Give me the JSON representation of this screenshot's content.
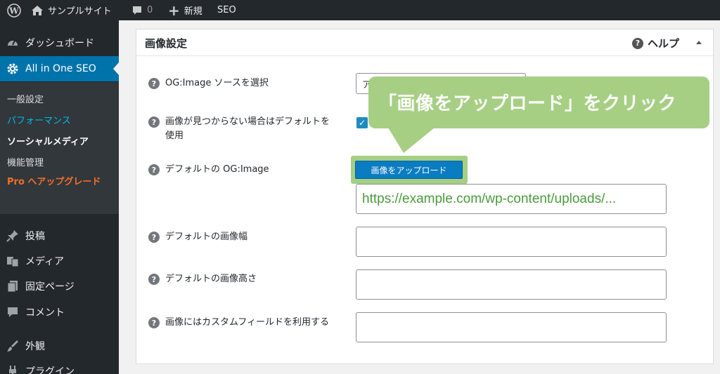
{
  "adminbar": {
    "site_name": "サンプルサイト",
    "comments_count": "0",
    "new_label": "新規",
    "seo_label": "SEO"
  },
  "sidebar": {
    "dashboard": "ダッシュボード",
    "aioseo": "All in One SEO",
    "submenu": {
      "general": "一般設定",
      "performance": "パフォーマンス",
      "social": "ソーシャルメディア",
      "features": "機能管理",
      "pro_prefix": "Pro",
      "pro_rest": " へアップグレード"
    },
    "posts": "投稿",
    "media": "メディア",
    "pages": "固定ページ",
    "comments": "コメント",
    "appearance": "外観",
    "plugins": "プラグイン"
  },
  "panel": {
    "title": "画像設定",
    "help": "ヘルプ",
    "fields": {
      "og_source_label": "OG:Image ソースを選択",
      "og_source_value": "ア",
      "default_if_missing_label": "画像が見つからない場合はデフォルトを使用",
      "default_og_label": "デフォルトの OG:Image",
      "upload_button": "画像をアップロード",
      "default_og_url": "https://example.com/wp-content/uploads/...",
      "default_width_label": "デフォルトの画像幅",
      "default_height_label": "デフォルトの画像高さ",
      "custom_field_label": "画像にはカスタムフィールドを利用する"
    }
  },
  "callout": {
    "text": "「画像をアップロード」をクリック"
  },
  "colors": {
    "adminbar": "#23282d",
    "current_menu": "#0073aa",
    "callout": "#a6cf84",
    "url_text": "#4a9a3c",
    "pro": "#f56e28"
  }
}
